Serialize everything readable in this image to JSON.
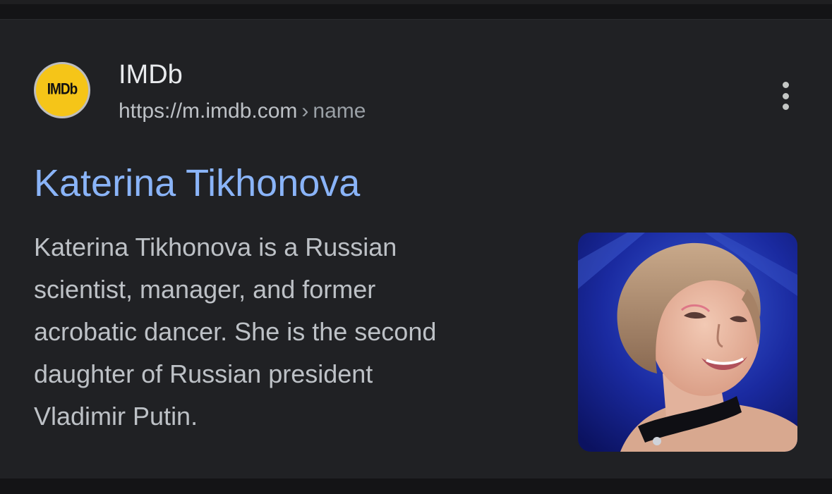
{
  "result": {
    "favicon_text": "IMDb",
    "site_name": "IMDb",
    "url_domain": "https://m.imdb.com",
    "url_separator": "›",
    "url_path": "name",
    "more_icon": "more-vert-icon",
    "title": "Katerina Tikhonova",
    "snippet_lines": [
      "Katerina Tikhonova is a Russian",
      "scientist, manager, and former",
      "acrobatic dancer. She is the second",
      "daughter of Russian president",
      "Vladimir Putin."
    ]
  },
  "colors": {
    "card_background": "#202124",
    "title_link": "#8ab4f8",
    "favicon_yellow": "#f5c518",
    "text_secondary": "#bdc1c6"
  }
}
